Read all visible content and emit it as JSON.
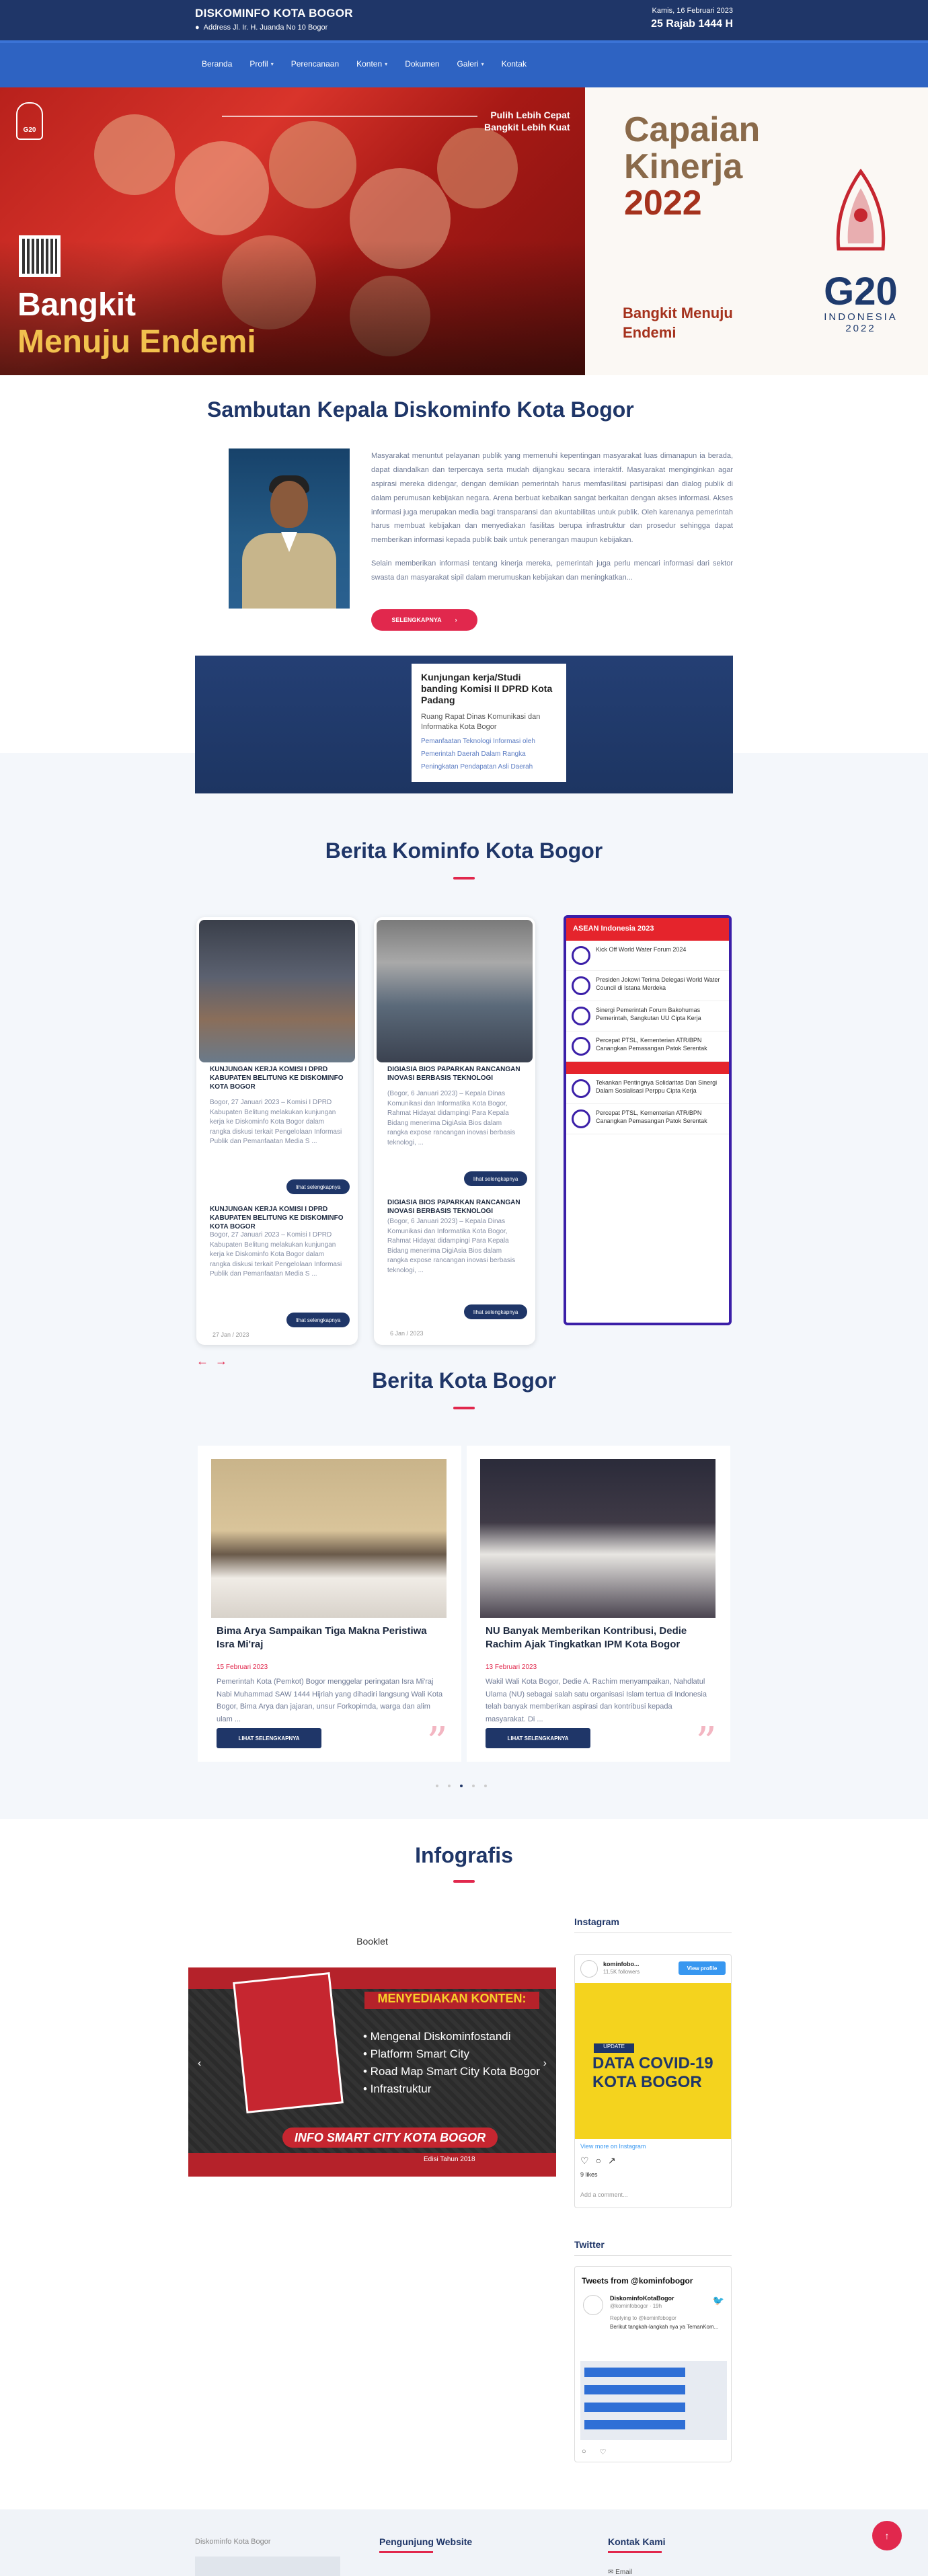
{
  "header": {
    "site_name": "DISKOMINFO KOTA BOGOR",
    "address": "Address Jl. Ir. H. Juanda No 10 Bogor",
    "date": "Kamis, 16 Februari 2023",
    "hijri": "25 Rajab 1444 H"
  },
  "nav": {
    "items": [
      {
        "label": "Beranda"
      },
      {
        "label": "Profil"
      },
      {
        "label": "Perencanaan"
      },
      {
        "label": "Konten"
      },
      {
        "label": "Dokumen"
      },
      {
        "label": "Galeri"
      },
      {
        "label": "Kontak"
      }
    ]
  },
  "hero": {
    "logo_text": "G20",
    "slogan_line1": "Pulih Lebih Cepat",
    "slogan_line2": "Bangkit Lebih Kuat",
    "title_line1": "Bangkit",
    "title_line2": "Menuju Endemi",
    "right_title_1": "Capaian",
    "right_title_2": "Kinerja",
    "right_title_3": "2022",
    "right_sub_1": "Bangkit Menuju",
    "right_sub_2": "Endemi",
    "g20_text": "G20",
    "g20_country": "INDONESIA",
    "g20_year": "2022"
  },
  "sambutan": {
    "title": "Sambutan Kepala Diskominfo Kota Bogor",
    "paragraph1": "Masyarakat menuntut pelayanan publik yang memenuhi kepentingan masyarakat luas dimanapun ia berada, dapat diandalkan dan terpercaya serta mudah dijangkau secara interaktif. Masyarakat menginginkan agar aspirasi mereka didengar, dengan demikian pemerintah harus memfasilitasi partisipasi dan dialog publik di dalam perumusan kebijakan negara. Arena berbuat kebaikan sangat berkaitan dengan akses informasi. Akses informasi juga merupakan media bagi transparansi dan akuntabilitas untuk publik. Oleh karenanya pemerintah harus membuat kebijakan dan menyediakan fasilitas berupa infrastruktur dan prosedur sehingga dapat memberikan informasi kepada publik baik untuk penerangan maupun kebijakan.",
    "paragraph2": "Selain memberikan informasi tentang kinerja mereka, pemerintah juga perlu mencari informasi dari sektor swasta dan masyarakat sipil dalam merumuskan kebijakan dan meningkatkan...",
    "button": "SELENGKAPNYA",
    "button_arrow": "›"
  },
  "kunjungan": {
    "title": "Kunjungan kerja/Studi banding Komisi II DPRD Kota Padang",
    "subtitle": "Ruang Rapat Dinas Komunikasi dan Informatika Kota Bogor",
    "links": [
      "Pemanfaatan Teknologi Informasi oleh",
      "Pemerintah Daerah Dalam Rangka",
      "Peningkatan Pendapatan Asli Daerah"
    ]
  },
  "berita_kominfo": {
    "title": "Berita Kominfo Kota Bogor",
    "cards": [
      {
        "title": "KUNJUNGAN KERJA KOMISI I DPRD KABUPATEN BELITUNG KE DISKOMINFO KOTA BOGOR",
        "body": "Bogor, 27 Januari 2023 – Komisi I DPRD Kabupaten Belitung melakukan kunjungan kerja ke Diskominfo Kota Bogor dalam rangka diskusi terkait Pengelolaan Informasi Publik dan Pemanfaatan Media S ...",
        "button": "lihat selengkapnya",
        "title2": "KUNJUNGAN KERJA KOMISI I DPRD KABUPATEN BELITUNG KE DISKOMINFO KOTA BOGOR",
        "body2": "Bogor, 27 Januari 2023 – Komisi I DPRD Kabupaten Belitung melakukan kunjungan kerja ke Diskominfo Kota Bogor dalam rangka diskusi terkait Pengelolaan Informasi Publik dan Pemanfaatan Media S ...",
        "button2": "lihat selengkapnya",
        "date": "27 Jan / 2023"
      },
      {
        "title": "DIGIASIA BIOS PAPARKAN RANCANGAN INOVASI BERBASIS TEKNOLOGI",
        "body": "(Bogor, 6 Januari 2023) – Kepala Dinas Komunikasi dan Informatika Kota Bogor, Rahmat Hidayat didampingi Para Kepala Bidang menerima DigiAsia Bios dalam rangka expose rancangan inovasi berbasis teknologi, ...",
        "button": "lihat selengkapnya",
        "title2": "DIGIASIA BIOS PAPARKAN RANCANGAN INOVASI BERBASIS TEKNOLOGI",
        "body2": "(Bogor, 6 Januari 2023) – Kepala Dinas Komunikasi dan Informatika Kota Bogor, Rahmat Hidayat didampingi Para Kepala Bidang menerima DigiAsia Bios dalam rangka expose rancangan inovasi berbasis teknologi, ...",
        "button2": "lihat selengkapnya",
        "date": "6 Jan / 2023"
      }
    ],
    "asean_header": "ASEAN Indonesia 2023",
    "asean_items": [
      "Kick Off World Water Forum 2024",
      "Presiden Jokowi Terima Delegasi World Water Council di Istana Merdeka",
      "Sinergi Pemerintah Forum Bakohumas Pemerintah, Sangkutan UU Cipta Kerja",
      "Percepat PTSL, Kementerian ATR/BPN Canangkan Pemasangan Patok Serentak",
      "Tekankan Pentingnya Solidaritas Dan Sinergi Dalam Sosialisasi Perppu Cipta Kerja",
      "Percepat PTSL, Kementerian ATR/BPN Canangkan Pemasangan Patok Serentak"
    ],
    "prev": "←",
    "next": "→"
  },
  "berita_kota": {
    "title": "Berita Kota Bogor",
    "cards": [
      {
        "title": "Bima Arya Sampaikan Tiga Makna Peristiwa Isra Mi'raj",
        "date": "15 Februari 2023",
        "body": "Pemerintah Kota (Pemkot) Bogor menggelar peringatan Isra Mi'raj Nabi Muhammad SAW 1444 Hijriah yang dihadiri langsung Wali Kota Bogor, Bima Arya dan jajaran, unsur Forkopimda, warga dan alim ulam ...",
        "button": "LIHAT SELENGKAPNYA"
      },
      {
        "title": "NU Banyak Memberikan Kontribusi, Dedie Rachim Ajak Tingkatkan IPM Kota Bogor",
        "date": "13 Februari 2023",
        "body": "Wakil Wali Kota Bogor, Dedie A. Rachim menyampaikan, Nahdlatul Ulama (NU) sebagai salah satu organisasi Islam tertua di Indonesia telah banyak memberikan aspirasi dan kontribusi kepada masyarakat. Di ...",
        "button": "LIHAT SELENGKAPNYA"
      }
    ]
  },
  "infografis": {
    "title": "Infografis",
    "booklet_label": "Booklet",
    "booklet_header": "MENYEDIAKAN KONTEN:",
    "booklet_items": [
      "• Mengenal Diskominfostandi",
      "• Platform Smart City",
      "• Road Map Smart City Kota Bogor",
      "• Infrastruktur"
    ],
    "booklet_footer": "INFO SMART CITY KOTA BOGOR",
    "booklet_edition": "Edisi Tahun 2018",
    "prev": "‹",
    "next": "›"
  },
  "instagram": {
    "heading": "Instagram",
    "account": "kominfobo...",
    "followers": "11.5K followers",
    "view_profile": "View profile",
    "update_label": "UPDATE",
    "covid_line1": "DATA COVID-19",
    "covid_line2": "KOTA BOGOR",
    "view_more": "View more on Instagram",
    "likes": "9 likes",
    "comment": "Add a comment..."
  },
  "twitter": {
    "heading": "Twitter",
    "title": "Tweets from @kominfobogor",
    "name": "DiskominfoKotaBogor",
    "handle": "@kominfobogor · 19h",
    "replying": "Replying to @kominfobogor",
    "text": "Berikut tangkah-langkah nya ya TemanKom..."
  },
  "footer": {
    "col1": "Diskominfo Kota Bogor",
    "col2": "Pengunjung Website",
    "col3": "Kontak Kami",
    "email": "✉ Email"
  },
  "back_to_top": "↑"
}
